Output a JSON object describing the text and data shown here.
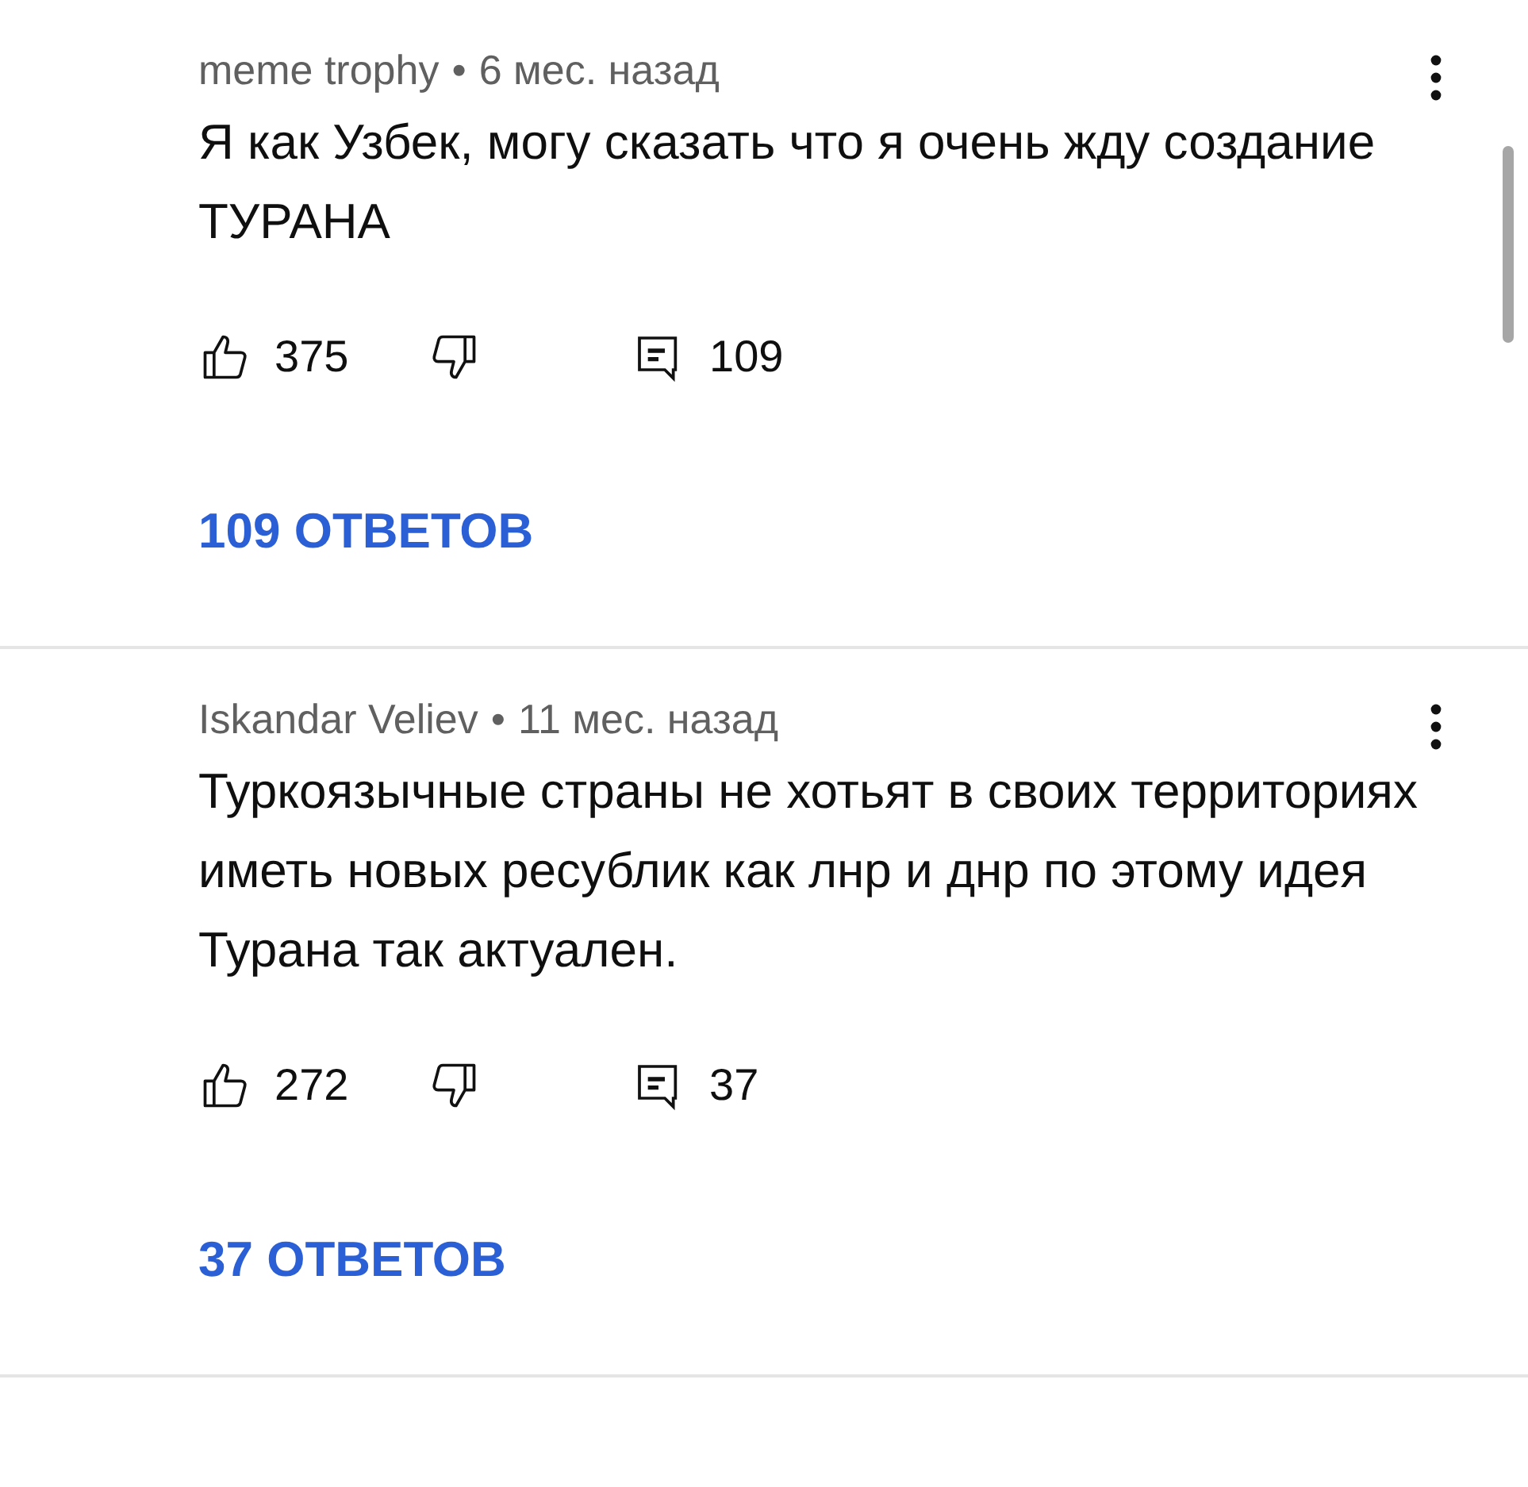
{
  "comments": [
    {
      "author": "meme trophy",
      "separator": "•",
      "time": "6 мес. назад",
      "text": "Я как Узбек, могу сказать что я очень жду создание ТУРАНА",
      "likes": "375",
      "reply_count": "109",
      "replies_link": "109 ОТВЕТОВ"
    },
    {
      "author": "Iskandar Veliev",
      "separator": "•",
      "time": "11 мес. назад",
      "text": "Туркоязычные страны не хотьят в своих территориях иметь новых ресублик как лнр и днр по этому идея Турана так актуален.",
      "likes": "272",
      "reply_count": "37",
      "replies_link": "37 ОТВЕТОВ"
    }
  ]
}
